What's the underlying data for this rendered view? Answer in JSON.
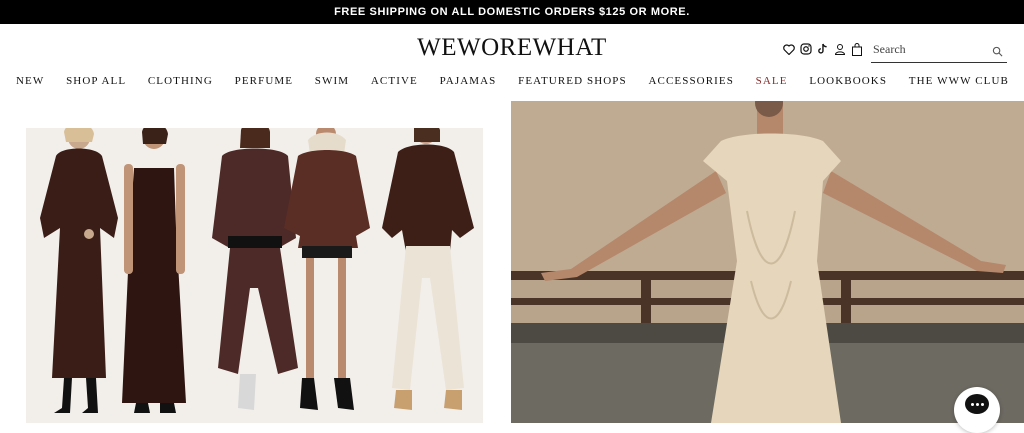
{
  "promo": {
    "text": "FREE SHIPPING ON ALL DOMESTIC ORDERS $125 OR MORE."
  },
  "header": {
    "logo": "WEWOREWHAT",
    "icons": [
      "heart-icon",
      "instagram-icon",
      "tiktok-icon",
      "account-icon",
      "bag-icon"
    ],
    "search": {
      "placeholder": "Search",
      "value": ""
    }
  },
  "nav": {
    "items": [
      "NEW",
      "SHOP ALL",
      "CLOTHING",
      "PERFUME",
      "SWIM",
      "ACTIVE",
      "PAJAMAS",
      "FEATURED SHOPS",
      "ACCESSORIES",
      "SALE",
      "LOOKBOOKS",
      "THE WWW CLUB"
    ]
  },
  "colors": {
    "promo_bg": "#000000",
    "sale": "#8b2a2a",
    "brown_garment": "#3d1d16",
    "cream_dress": "#e8d9bf"
  },
  "hero": {
    "left_image": "five-models-brown-outfits",
    "right_image": "model-cream-dress-railing"
  },
  "chat": {
    "icon": "chat-icon"
  }
}
